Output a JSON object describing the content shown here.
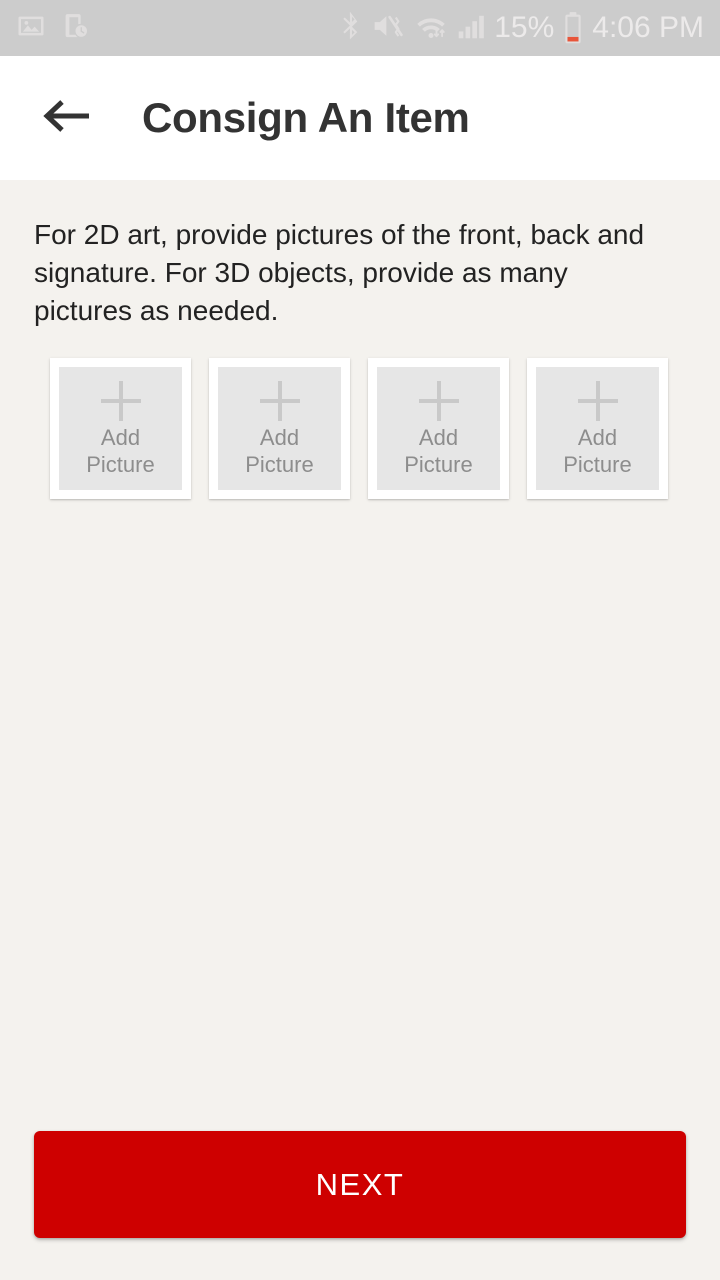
{
  "status_bar": {
    "background_color": "#cccccc",
    "left_icons": [
      {
        "name": "image-icon",
        "label": "gallery"
      },
      {
        "name": "device-clock-icon",
        "label": "scheduled-device"
      }
    ],
    "right_icons": [
      {
        "name": "bluetooth-icon",
        "label": "bluetooth"
      },
      {
        "name": "mute-vibrate-icon",
        "label": "sound-off-vibrate"
      },
      {
        "name": "wifi-icon",
        "label": "wifi-data-transfer"
      },
      {
        "name": "cellular-signal-icon",
        "label": "signal-bars"
      }
    ],
    "battery_percent": "15%",
    "battery_icon": "battery-low-icon",
    "time": "4:06 PM"
  },
  "header": {
    "back_icon": "arrow-left-icon",
    "title": "Consign An Item",
    "background_color": "#ffffff",
    "title_color": "#333333"
  },
  "main": {
    "instructions": "For 2D art, provide pictures of the front, back and signature. For 3D objects, provide as many pictures as needed.",
    "background_color": "#f4f2ee",
    "picture_slots": [
      {
        "icon": "plus-icon",
        "label_line1": "Add",
        "label_line2": "Picture"
      },
      {
        "icon": "plus-icon",
        "label_line1": "Add",
        "label_line2": "Picture"
      },
      {
        "icon": "plus-icon",
        "label_line1": "Add",
        "label_line2": "Picture"
      },
      {
        "icon": "plus-icon",
        "label_line1": "Add",
        "label_line2": "Picture"
      }
    ]
  },
  "footer": {
    "next_label": "NEXT",
    "next_color": "#ce0000",
    "next_text_color": "#ffffff"
  }
}
